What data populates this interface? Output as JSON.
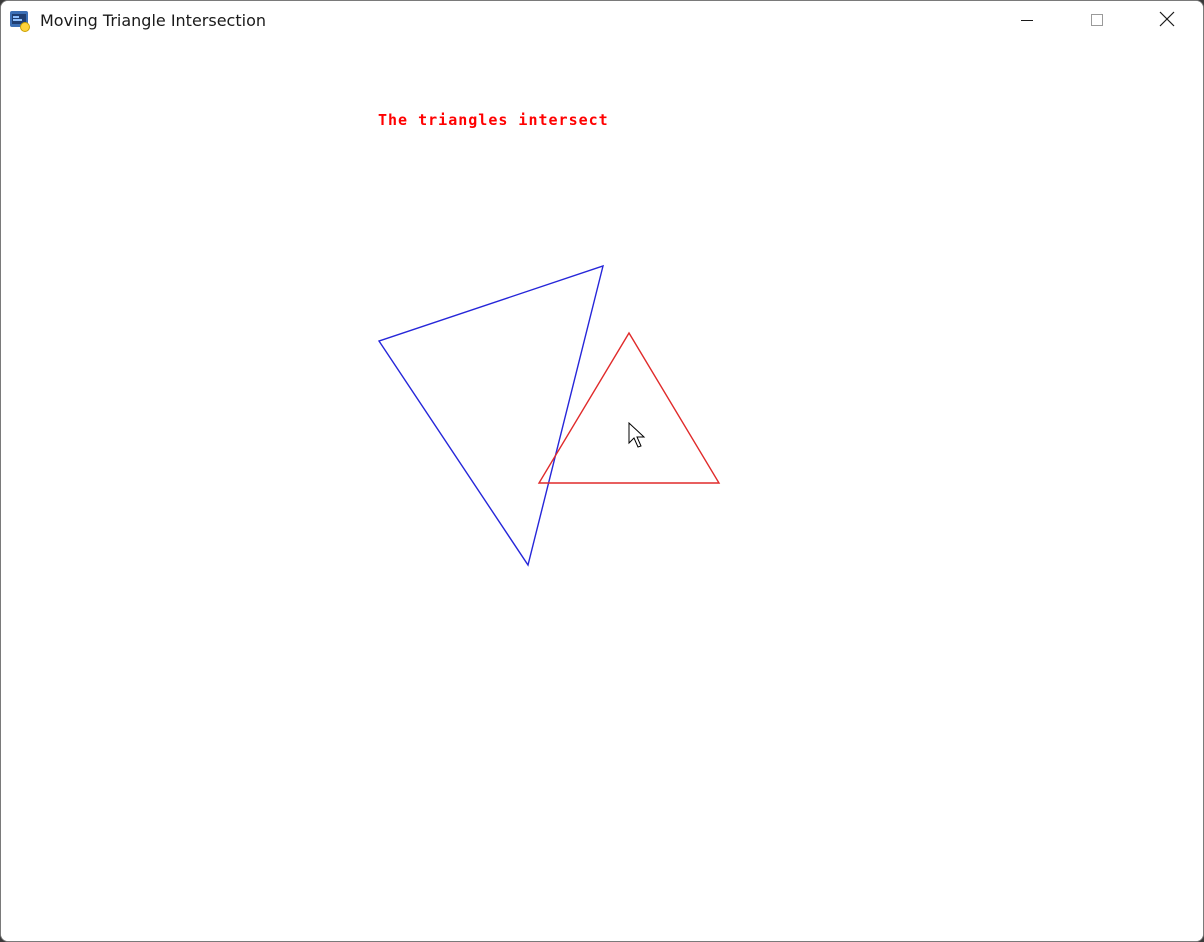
{
  "window": {
    "title": "Moving Triangle Intersection",
    "app_icon": "python-app-icon",
    "controls": {
      "minimize_icon": "minimize-icon",
      "maximize_icon": "maximize-icon",
      "close_icon": "close-icon"
    }
  },
  "canvas": {
    "status_message": "The triangles intersect",
    "status_color": "#ff0000",
    "triangles": [
      {
        "name": "blue-triangle",
        "stroke": "#2626d9"
      },
      {
        "name": "red-triangle",
        "stroke": "#e02a2a"
      }
    ],
    "cursor_icon": "arrow-cursor-icon"
  }
}
